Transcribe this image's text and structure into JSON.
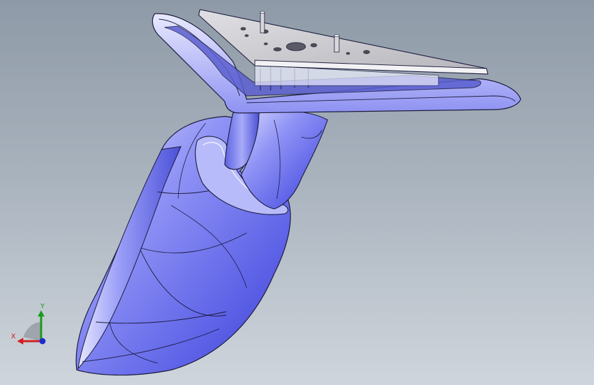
{
  "viewport": {
    "background_top": "#8e9aa7",
    "background_bottom": "#cfd5dc"
  },
  "model": {
    "body_color": "#7b80f0",
    "body_highlight": "#c9cbfb",
    "edge_color": "#1a1a3a",
    "plate_color": "#c8c8cc"
  },
  "triad": {
    "x_label": "X",
    "y_label": "Y",
    "x_color": "#d12020",
    "y_color": "#1a9a1a",
    "z_color": "#1a2bd0"
  }
}
